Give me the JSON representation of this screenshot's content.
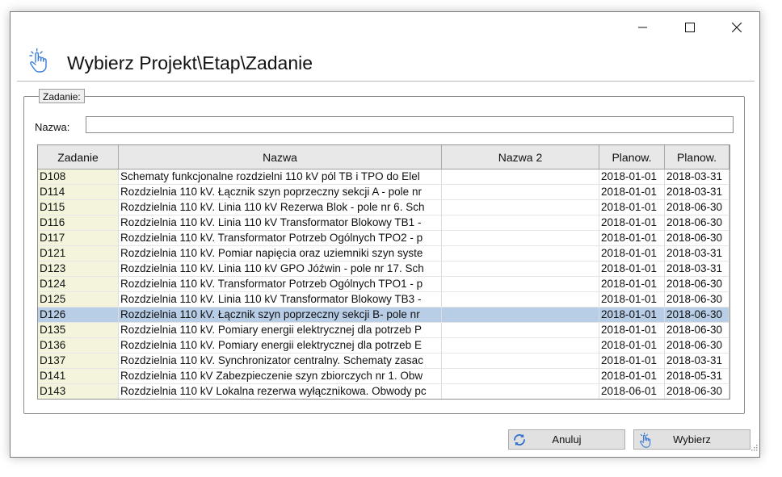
{
  "dialog": {
    "title": "Wybierz Projekt\\Etap\\Zadanie",
    "icon": "hand-pointer-icon"
  },
  "groupbox": {
    "legend": "Zadanie:"
  },
  "filter": {
    "label": "Nazwa:",
    "value": "",
    "placeholder": ""
  },
  "grid": {
    "columns": [
      "Zadanie",
      "Nazwa",
      "Nazwa 2",
      "Planow.",
      "Planow."
    ],
    "rows": [
      {
        "zadanie": "D108",
        "nazwa": "Schematy funkcjonalne rozdzielni 110 kV  pól TB i TPO do Elel",
        "nazwa2": "",
        "planow1": "2018-01-01",
        "planow2": "2018-03-31"
      },
      {
        "zadanie": "D114",
        "nazwa": "Rozdzielnia 110 kV. Łącznik szyn poprzeczny sekcji A - pole nr",
        "nazwa2": "",
        "planow1": "2018-01-01",
        "planow2": "2018-03-31"
      },
      {
        "zadanie": "D115",
        "nazwa": "Rozdzielnia 110 kV. Linia 110 kV Rezerwa Blok - pole nr 6. Sch",
        "nazwa2": "",
        "planow1": "2018-01-01",
        "planow2": "2018-06-30"
      },
      {
        "zadanie": "D116",
        "nazwa": "Rozdzielnia 110 kV. Linia 110 kV Transformator Blokowy TB1 -",
        "nazwa2": "",
        "planow1": "2018-01-01",
        "planow2": "2018-06-30"
      },
      {
        "zadanie": "D117",
        "nazwa": "Rozdzielnia 110 kV. Transformator Potrzeb Ogólnych TPO2 - p",
        "nazwa2": "",
        "planow1": "2018-01-01",
        "planow2": "2018-06-30"
      },
      {
        "zadanie": "D121",
        "nazwa": "Rozdzielnia 110 kV. Pomiar napięcia oraz uziemniki szyn syste",
        "nazwa2": "",
        "planow1": "2018-01-01",
        "planow2": "2018-03-31"
      },
      {
        "zadanie": "D123",
        "nazwa": "Rozdzielnia 110 kV. Linia 110 kV GPO Jóźwin - pole nr 17. Sch",
        "nazwa2": "",
        "planow1": "2018-01-01",
        "planow2": "2018-03-31"
      },
      {
        "zadanie": "D124",
        "nazwa": "Rozdzielnia 110 kV. Transformator Potrzeb Ogólnych TPO1 - p",
        "nazwa2": "",
        "planow1": "2018-01-01",
        "planow2": "2018-06-30"
      },
      {
        "zadanie": "D125",
        "nazwa": "Rozdzielnia 110 kV. Linia 110 kV Transformator Blokowy TB3 -",
        "nazwa2": "",
        "planow1": "2018-01-01",
        "planow2": "2018-06-30"
      },
      {
        "zadanie": "D126",
        "nazwa": "Rozdzielnia 110 kV. Łącznik szyn poprzeczny sekcji B- pole nr",
        "nazwa2": "",
        "planow1": "2018-01-01",
        "planow2": "2018-06-30",
        "selected": true
      },
      {
        "zadanie": "D135",
        "nazwa": "Rozdzielnia 110 kV. Pomiary energii elektrycznej dla potrzeb P",
        "nazwa2": "",
        "planow1": "2018-01-01",
        "planow2": "2018-06-30"
      },
      {
        "zadanie": "D136",
        "nazwa": "Rozdzielnia 110 kV. Pomiary energii elektrycznej dla potrzeb E",
        "nazwa2": "",
        "planow1": "2018-01-01",
        "planow2": "2018-06-30"
      },
      {
        "zadanie": "D137",
        "nazwa": "Rozdzielnia 110 kV. Synchronizator centralny. Schematy zasac",
        "nazwa2": "",
        "planow1": "2018-01-01",
        "planow2": "2018-03-31"
      },
      {
        "zadanie": "D141",
        "nazwa": "Rozdzielnia 110 kV Zabezpieczenie szyn zbiorczych nr 1. Obw",
        "nazwa2": "",
        "planow1": "2018-01-01",
        "planow2": "2018-05-31"
      },
      {
        "zadanie": "D143",
        "nazwa": "Rozdzielnia 110 kV Lokalna rezerwa wyłącznikowa. Obwody pc",
        "nazwa2": "",
        "planow1": "2018-06-01",
        "planow2": "2018-06-30"
      }
    ]
  },
  "buttons": {
    "cancel": {
      "label": "Anuluj",
      "icon": "refresh-icon"
    },
    "select": {
      "label": "Wybierz",
      "icon": "hand-pointer-icon"
    }
  },
  "colors": {
    "selection": "#b8cde6",
    "first_column": "#f4f4dc",
    "header_bg": "#e8e8e8",
    "button_bg": "#e1e1e1"
  }
}
